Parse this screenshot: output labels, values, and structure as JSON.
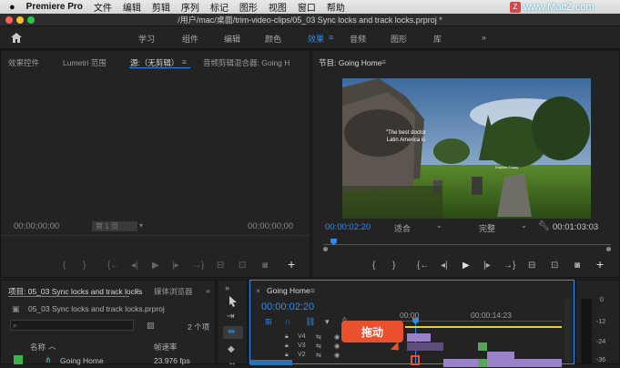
{
  "menubar": {
    "apple": "",
    "app": "Premiere Pro",
    "items": [
      "文件",
      "编辑",
      "剪辑",
      "序列",
      "标记",
      "图形",
      "视图",
      "窗口",
      "帮助"
    ]
  },
  "window": {
    "title": "/用户/mac/桌面/trim-video-clips/05_03 Sync locks and track locks.prproj *",
    "watermark": "www.MacZ.com"
  },
  "workspaces": {
    "items": [
      "学习",
      "组件",
      "编辑",
      "颜色",
      "效果",
      "音频",
      "图形",
      "库"
    ],
    "active": "效果",
    "more": "»"
  },
  "source_panel": {
    "tabs": [
      "效果控件",
      "Lumetri 范围",
      "源:（无剪辑）",
      "音频剪辑混合器: Going H"
    ],
    "timecode_left": "00;00;00;00",
    "page": "第 1 页",
    "timecode_right": "00;00;00;00"
  },
  "program_panel": {
    "tab": "节目: Going Home",
    "timecode": "00:00:02:20",
    "fit": "适合",
    "quality": "完整",
    "duration": "00:01:03:03",
    "video_caption_line1": "\"The best doctor",
    "video_caption_line2": "Latin America is",
    "video_caption2": "Explore Today"
  },
  "project_panel": {
    "tab": "项目: 05_03 Sync locks and track locks",
    "tab2": "媒体浏览器",
    "more": "»",
    "file": "05_03 Sync locks and track locks.prproj",
    "search_placeholder": "",
    "count": "2 个项",
    "col_name": "名称",
    "col_fps": "帧速率",
    "row_name": "Going Home",
    "row_fps": "23.976 fps"
  },
  "timeline_panel": {
    "tab": "Going Home",
    "timecode": "00:00:02:20",
    "ruler_start": "00:00",
    "ruler_mid": "00:00:14:23",
    "tracks": [
      "V4",
      "V3",
      "V2"
    ],
    "annotation": "拖动"
  },
  "audio_meter": {
    "labels": [
      "0",
      "-12",
      "-24",
      "-36"
    ]
  },
  "colors": {
    "accent": "#2d8ceb",
    "annotation": "#e8502e",
    "clip_purple": "#9a82c8",
    "clip_green": "#5aa35a"
  }
}
